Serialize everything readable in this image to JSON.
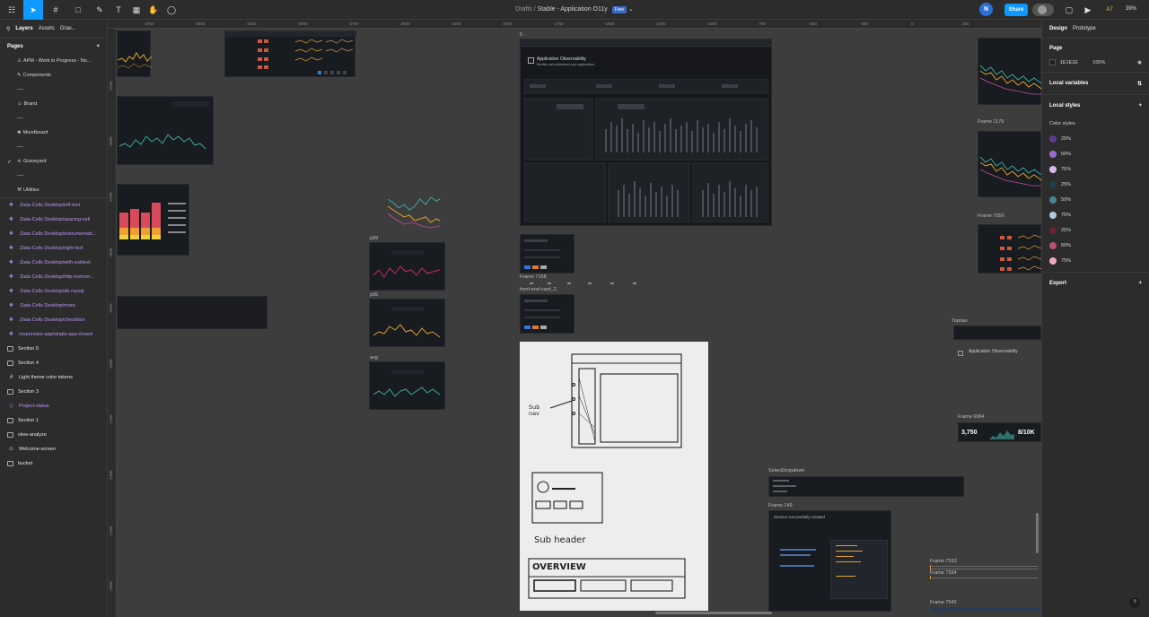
{
  "topbar": {
    "drafts": "Drafts",
    "separator": "/",
    "file_name": "Stable - Application O11y",
    "badge": "Free",
    "avatar": "N",
    "share": "Share",
    "zoom": "39%",
    "ai": "A7"
  },
  "left": {
    "tab_layers": "Layers",
    "tab_assets": "Assets",
    "tab_grav": "Grav...",
    "pages_heading": "Pages",
    "pages": [
      {
        "label": "APM - Work in Progress - No...",
        "icon": "construction-icon"
      },
      {
        "label": "Components",
        "icon": "pencil-icon"
      },
      {
        "label": "----"
      },
      {
        "label": "Brand",
        "icon": "smile-icon"
      },
      {
        "label": "----"
      },
      {
        "label": "Moodboard",
        "icon": "palette-icon"
      },
      {
        "label": "----"
      },
      {
        "label": "Graveyard",
        "icon": "skull-icon",
        "checked": true
      },
      {
        "label": "----"
      },
      {
        "label": "Utilities",
        "icon": "tools-icon"
      }
    ],
    "layers": [
      {
        "label": ".Data Cells Desktop/left-text",
        "kind": "component"
      },
      {
        "label": ".Data Cells Desktop/spacing-cell",
        "kind": "component"
      },
      {
        "label": ".Data Cells Desktop/instrumentati...",
        "kind": "component"
      },
      {
        "label": ".Data Cells Desktop/right-text",
        "kind": "component"
      },
      {
        "label": ".Data Cells Desktop/with-subtext",
        "kind": "component"
      },
      {
        "label": ".Data Cells Desktop/http-instrum...",
        "kind": "component"
      },
      {
        "label": ".Data Cells Desktop/db-mysql",
        "kind": "component"
      },
      {
        "label": ".Data Cells Desktop/more",
        "kind": "component"
      },
      {
        "label": ".Data Cells Desktop/checkbox",
        "kind": "component"
      },
      {
        "label": "responsive-app/single-app-closed",
        "kind": "component"
      },
      {
        "label": "Section 5",
        "kind": "section"
      },
      {
        "label": "Section 4",
        "kind": "section"
      },
      {
        "label": "Light theme color tokens",
        "kind": "grid"
      },
      {
        "label": "Section 3",
        "kind": "section"
      },
      {
        "label": "Project-status",
        "kind": "instance"
      },
      {
        "label": "Section 1",
        "kind": "section"
      },
      {
        "label": "view-analyze",
        "kind": "section"
      },
      {
        "label": "Welcome-screen",
        "kind": "emoji"
      },
      {
        "label": "bucket",
        "kind": "section"
      }
    ]
  },
  "canvas": {
    "ruler_top": [
      "-3750",
      "-3500",
      "-3250",
      "-3000",
      "-2750",
      "-2500",
      "-2250",
      "-2000",
      "-1750",
      "-1500",
      "-1250",
      "-1000",
      "-750",
      "-500",
      "-250",
      "0",
      "250"
    ],
    "ruler_left": [
      "-3250",
      "-3000",
      "-2750",
      "-2500",
      "-2250",
      "-2000",
      "-1750",
      "-1500",
      "-1250",
      "-1000",
      "-750"
    ],
    "labels": {
      "frame_5": "5",
      "p99": "p99",
      "p95": "p95",
      "avg": "avg",
      "frame_7158": "Frame 7158",
      "front_end_card": "front-end-card_2",
      "frame_1179": "Frame 1179",
      "frame_7056": "Frame 7056",
      "topnav": "Topnav",
      "frame_6994": "Frame 6994",
      "select_dropdown": "SelectDropdown",
      "frame_149": "Frame 149",
      "frame_7533": "Frame 7533",
      "frame_7534": "Frame 7534",
      "frame_7545": "Frame 7545"
    },
    "app_obs_title": "Application Observability",
    "app_obs_sub": "Monitor and understand your applications",
    "topnav_title": "Application Observability",
    "success_msg": "Service successfully created",
    "stat1": "3,750",
    "stat2": "8/10K",
    "sketch_subnav": "Sub nav",
    "sketch_subheader": "Sub header",
    "sketch_overview": "OVERVIEW"
  },
  "right": {
    "tab_design": "Design",
    "tab_prototype": "Prototype",
    "page_heading": "Page",
    "page_color": "1E1E1E",
    "page_opacity": "100%",
    "local_variables": "Local variables",
    "local_styles": "Local styles",
    "color_styles": "Color styles",
    "colors": [
      {
        "label": "25%",
        "hex": "#5b3a8c"
      },
      {
        "label": "50%",
        "hex": "#9b6bd0"
      },
      {
        "label": "75%",
        "hex": "#d7b8f2"
      },
      {
        "label": "25%",
        "hex": "#1f3f48"
      },
      {
        "label": "50%",
        "hex": "#4e8497"
      },
      {
        "label": "75%",
        "hex": "#a9cde0"
      },
      {
        "label": "25%",
        "hex": "#6a2434"
      },
      {
        "label": "50%",
        "hex": "#b85471"
      },
      {
        "label": "75%",
        "hex": "#f0a8bd"
      }
    ],
    "export": "Export"
  }
}
